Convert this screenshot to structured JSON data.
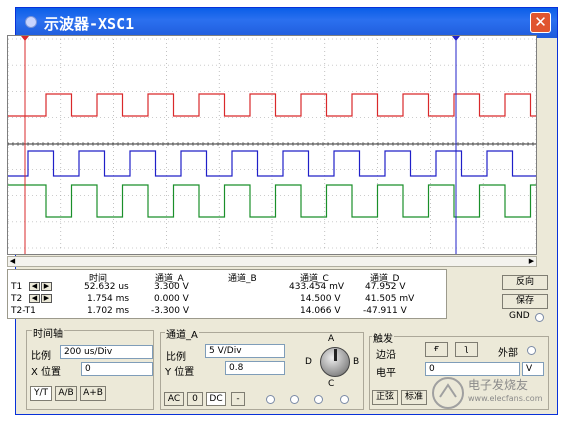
{
  "window": {
    "title": "示波器-XSC1",
    "close_glyph": "✕"
  },
  "screen": {
    "bg": "#ffffff",
    "channel_colors": {
      "A": "#d9292b",
      "B": "#2020c8",
      "C": "#1a8f2a"
    },
    "cursor_colors": {
      "T1": "#d9292b",
      "T2": "#2020c8"
    },
    "grid": true
  },
  "readout": {
    "headers": {
      "time": "时间",
      "a": "通道_A",
      "b": "通道_B",
      "c": "通道_C",
      "d": "通道_D"
    },
    "rows": [
      {
        "label": "T1",
        "time": "52.632 us",
        "a": "3.300 V",
        "b": "",
        "c": "433.454 mV",
        "d": "47.952 V"
      },
      {
        "label": "T2",
        "time": "1.754 ms",
        "a": "0.000 V",
        "b": "",
        "c": "14.500 V",
        "d": "41.505 mV"
      },
      {
        "label": "T2-T1",
        "time": "1.702 ms",
        "a": "-3.300 V",
        "b": "",
        "c": "14.066 V",
        "d": "-47.911 V"
      }
    ],
    "left_arrow": "◀",
    "right_arrow": "▶"
  },
  "side_buttons": {
    "reverse": "反向",
    "save": "保存",
    "gnd": "GND"
  },
  "timebase": {
    "group": "时间轴",
    "scale_label": "比例",
    "scale_value": "200 us/Div",
    "xpos_label": "X 位置",
    "xpos_value": "0",
    "mode_yt": "Y/T",
    "mode_ab": "A/B",
    "mode_aplusb": "A+B"
  },
  "channel_a": {
    "group": "通道_A",
    "scale_label": "比例",
    "scale_value": "5 V/Div",
    "ypos_label": "Y 位置",
    "ypos_value": "0.8",
    "ac": "AC",
    "zero": "0",
    "dc": "DC",
    "minus": "-"
  },
  "selector": {
    "a": "A",
    "b": "B",
    "c": "C",
    "d": "D"
  },
  "trigger": {
    "group": "触发",
    "edge_label": "边沿",
    "rise_glyph": "ғ",
    "fall_glyph": "ʅ",
    "external_label": "外部",
    "level_label": "电平",
    "level_value": "0",
    "level_unit": "V",
    "sine_label": "正弦",
    "standard_label": "标准"
  },
  "watermark": {
    "text": "电子发烧友",
    "url": "www.elecfans.com"
  }
}
